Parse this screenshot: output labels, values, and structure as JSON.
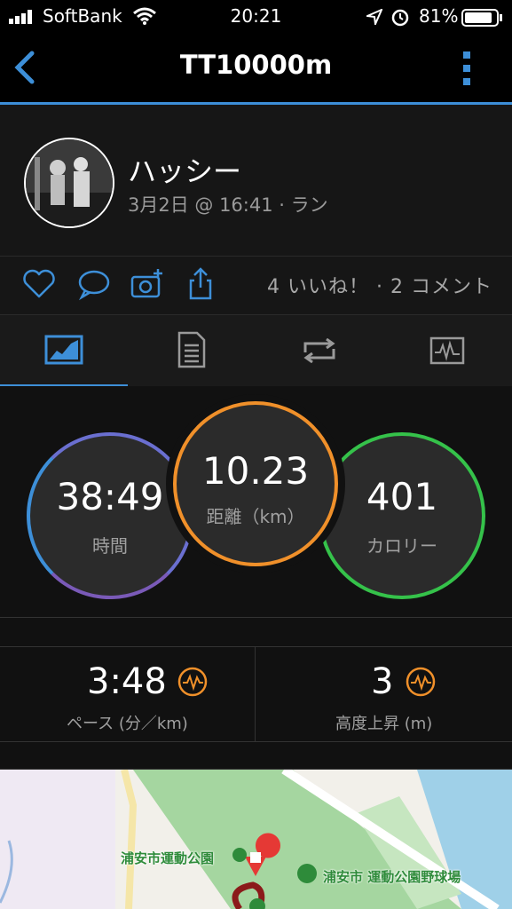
{
  "status_bar": {
    "carrier": "SoftBank",
    "time": "20:21",
    "battery": "81%"
  },
  "header": {
    "title": "TT10000m",
    "back_icon": "chevron-left-icon",
    "menu_icon": "kebab-menu-icon",
    "accent": "#3d8fd8"
  },
  "activity": {
    "user_name": "ハッシー",
    "meta": "3月2日 @ 16:41 · ラン",
    "counts": "4 いいね！ · 2 コメント"
  },
  "tabs": [
    {
      "icon": "stats-chart-icon",
      "active": true
    },
    {
      "icon": "document-list-icon",
      "active": false
    },
    {
      "icon": "laps-repeat-icon",
      "active": false
    },
    {
      "icon": "activity-graph-icon",
      "active": false
    }
  ],
  "rings": {
    "time": {
      "value": "38:49",
      "label": "時間"
    },
    "distance": {
      "value": "10.23",
      "label": "距離（km）"
    },
    "calories": {
      "value": "401",
      "label": "カロリー"
    }
  },
  "metrics": {
    "pace": {
      "value": "3:48",
      "label": "ペース (分／km)"
    },
    "ascent": {
      "value": "3",
      "label": "高度上昇 (m)"
    }
  },
  "map": {
    "label_park": "浦安市運動公園",
    "label_stadium": "浦安市 運動公園野球場"
  }
}
